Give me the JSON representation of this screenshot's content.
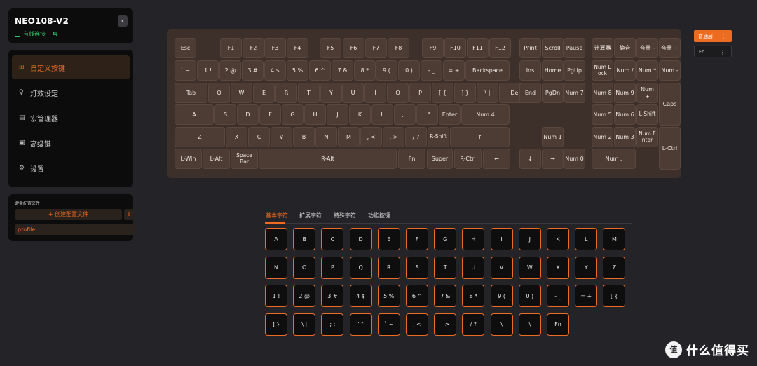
{
  "device": {
    "name": "NEO108-V2",
    "status": "有线连接",
    "collapse_icon": "‹",
    "link_icon": "⇆"
  },
  "nav": [
    {
      "label": "自定义按键",
      "icon": "⊞",
      "active": true
    },
    {
      "label": "灯效设定",
      "icon": "♀",
      "active": false
    },
    {
      "label": "宏管理器",
      "icon": "▤",
      "active": false
    },
    {
      "label": "高级键",
      "icon": "▣",
      "active": false
    },
    {
      "label": "设置",
      "icon": "⚙",
      "active": false
    }
  ],
  "profiles": {
    "title": "键盘配置文件",
    "create_label": "+ 创建配置文件",
    "import_icon": "⇩",
    "items": [
      "profile"
    ]
  },
  "keyboard": {
    "keys": [
      "Esc",
      "F1",
      "F2",
      "F3",
      "F4",
      "F5",
      "F6",
      "F7",
      "F8",
      "F9",
      "F10",
      "F11",
      "F12",
      "Print",
      "Scroll",
      "Pause",
      "计算器",
      "静音",
      "音量 -",
      "音量 +",
      "` ~",
      "1 !",
      "2 @",
      "3 #",
      "4 $",
      "5 %",
      "6 ^",
      "7 &",
      "8 *",
      "9 (",
      "0 )",
      "- _",
      "= +",
      "Backspace",
      "Ins",
      "Home",
      "PgUp",
      "Num Lock",
      "Num /",
      "Num *",
      "Num -",
      "Tab",
      "Q",
      "W",
      "E",
      "R",
      "T",
      "Y",
      "U",
      "I",
      "O",
      "P",
      "[ {",
      "] }",
      "\\ |",
      "Del",
      "End",
      "PgDn",
      "Num 7",
      "Num 8",
      "Num 9",
      "Num +",
      "Caps",
      "A",
      "S",
      "D",
      "F",
      "G",
      "H",
      "J",
      "K",
      "L",
      "; :",
      "' \"",
      "Enter",
      "Num 4",
      "Num 5",
      "Num 6",
      "L-Shift",
      "Z",
      "X",
      "C",
      "V",
      "B",
      "N",
      "M",
      ", <",
      ". >",
      "/ ?",
      "R-Shift",
      "↑",
      "Num 1",
      "Num 2",
      "Num 3",
      "Num Enter",
      "L-Ctrl",
      "L-Win",
      "L-Alt",
      "Space Bar",
      "R-Alt",
      "Fn",
      "Super",
      "R-Ctrl",
      "←",
      "↓",
      "→",
      "Num 0",
      "Num ."
    ]
  },
  "layers": [
    {
      "label": "普通层",
      "menu": "⋮"
    },
    {
      "label": "Fn",
      "menu": "⋮"
    }
  ],
  "tabs": [
    "基本字符",
    "扩展字符",
    "特殊字符",
    "功能按键"
  ],
  "charkeys": [
    "A",
    "B",
    "C",
    "D",
    "E",
    "F",
    "G",
    "H",
    "I",
    "J",
    "K",
    "L",
    "M",
    "N",
    "O",
    "P",
    "Q",
    "R",
    "S",
    "T",
    "U",
    "V",
    "W",
    "X",
    "Y",
    "Z",
    "1 !",
    "2 @",
    "3 #",
    "4 $",
    "5 %",
    "6 ^",
    "7 &",
    "8 *",
    "9 (",
    "0 )",
    "- _",
    "= +",
    "[ {",
    "] }",
    "\\ |",
    "; :",
    "' \"",
    "` ~",
    ", <",
    ". >",
    "/ ?",
    "\\",
    "\\",
    "Fn"
  ],
  "watermark": {
    "logo": "值",
    "text": "什么值得买"
  },
  "colors": {
    "accent": "#ee6b22",
    "success": "#2fc66a",
    "keyboard_bg": "#3d2f29"
  }
}
